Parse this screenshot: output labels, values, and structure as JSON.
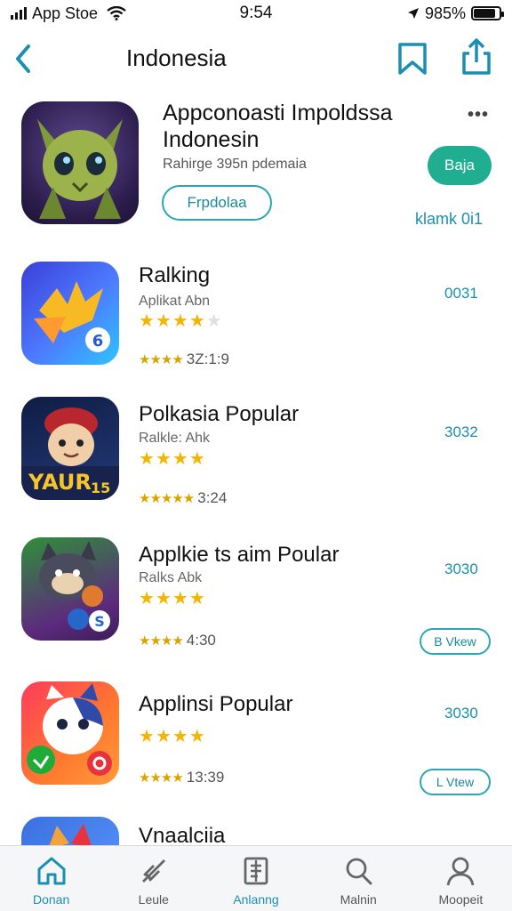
{
  "status": {
    "carrier": "App Stoe",
    "time": "9:54",
    "battery": "985%"
  },
  "nav": {
    "title": "Indonesia"
  },
  "featured": {
    "title": "Appconoasti Impoldssa Indonesin",
    "subtitle": "Rahirge 395n pdemaia",
    "get_label": "Baja",
    "outline_label": "Frpdolaa",
    "link_label": "klamk 0i1",
    "more_label": "•••"
  },
  "apps": [
    {
      "title": "Ralking",
      "subtitle": "Aplikat Abn",
      "rating": 4.5,
      "meta": "3Z:1:9",
      "code": "0031"
    },
    {
      "title": "Polkasia Popular",
      "subtitle": "Ralkle: Ahk",
      "rating": 3.5,
      "meta": "3:24",
      "code": "3032"
    },
    {
      "title": "Applkie ts aim Poular",
      "subtitle": "Ralks Abk",
      "rating": 3.5,
      "meta": "4:30",
      "code": "3030",
      "button": "B Vkew"
    },
    {
      "title": "Applinsi Popular",
      "subtitle": "",
      "rating": 3.5,
      "meta": "13:39",
      "code": "3030",
      "button": "L Vtew"
    },
    {
      "title": "Vnaalciia",
      "subtitle": "",
      "rating": 0,
      "meta": "",
      "code": ""
    }
  ],
  "tabs": [
    {
      "label": "Donan",
      "icon": "home-icon",
      "active": true
    },
    {
      "label": "Leule",
      "icon": "games-icon",
      "active": false
    },
    {
      "label": "Anlanng",
      "icon": "apps-icon",
      "active": false,
      "accent": true
    },
    {
      "label": "Malnin",
      "icon": "search-icon",
      "active": false
    },
    {
      "label": "Moopeit",
      "icon": "account-icon",
      "active": false
    }
  ],
  "colors": {
    "accent": "#1a8fb0",
    "get_button": "#1fae8f",
    "star": "#f4b400"
  }
}
